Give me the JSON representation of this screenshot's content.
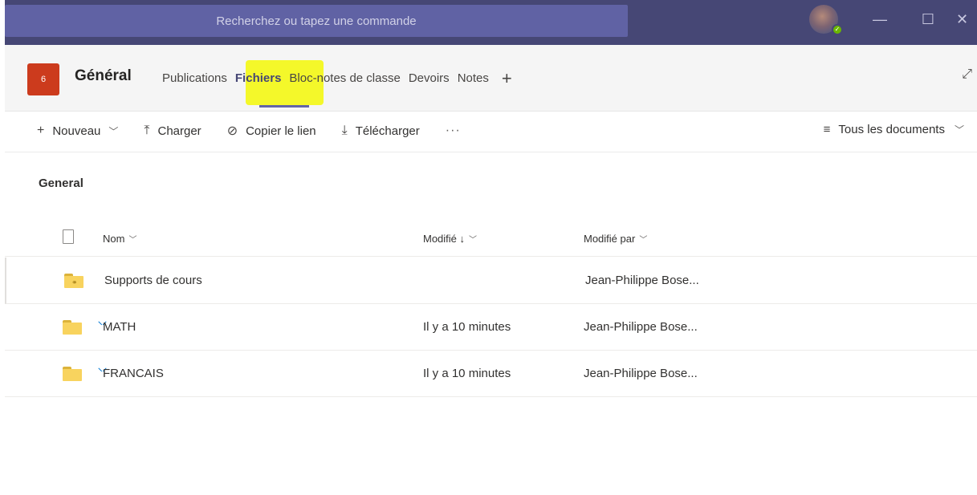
{
  "titlebar": {
    "search_placeholder": "Recherchez ou tapez une commande",
    "window_controls": {
      "minimize": "—",
      "maximize": "☐",
      "close": "✕"
    }
  },
  "channel": {
    "team_badge": "6",
    "title": "Général",
    "tabs": [
      {
        "label": "Publications",
        "active": false
      },
      {
        "label": "Fichiers",
        "active": true
      },
      {
        "label": "Bloc-notes de classe",
        "active": false
      },
      {
        "label": "Devoirs",
        "active": false
      },
      {
        "label": "Notes",
        "active": false
      }
    ],
    "add_tab": "+",
    "expand_icon": "⤢"
  },
  "toolbar": {
    "new_label": "Nouveau",
    "upload_label": "Charger",
    "copy_link_label": "Copier le lien",
    "download_label": "Télécharger",
    "more_label": "···",
    "view_label": "Tous les documents"
  },
  "files": {
    "folder_title": "General",
    "columns": {
      "name": "Nom",
      "modified": "Modifié ↓",
      "modified_by": "Modifié par"
    },
    "rows": [
      {
        "name": "Supports de cours",
        "modified": "",
        "modified_by": "Jean-Philippe Bose...",
        "icon": "linked-folder-icon",
        "syncing": false
      },
      {
        "name": "MATH",
        "modified": "Il y a 10 minutes",
        "modified_by": "Jean-Philippe Bose...",
        "icon": "folder-icon",
        "syncing": true
      },
      {
        "name": "FRANCAIS",
        "modified": "Il y a 10 minutes",
        "modified_by": "Jean-Philippe Bose...",
        "icon": "folder-icon",
        "syncing": true
      }
    ]
  },
  "colors": {
    "titlebar": "#464775",
    "search": "#6264a7",
    "team_badge": "#cc3b1d",
    "highlight": "#f4f82a",
    "folder": "#f8d35e",
    "sync": "#0078d4"
  }
}
